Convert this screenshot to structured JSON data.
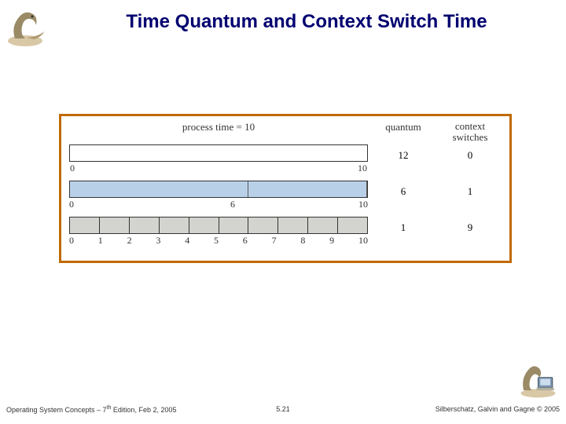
{
  "title": "Time Quantum and Context Switch Time",
  "figure": {
    "header_process": "process time = 10",
    "header_quantum": "quantum",
    "header_switches_l1": "context",
    "header_switches_l2": "switches",
    "rows": [
      {
        "quantum": "12",
        "switches": "0",
        "ticks": [
          "0",
          "10"
        ]
      },
      {
        "quantum": "6",
        "switches": "1",
        "ticks": [
          "0",
          "6",
          "10"
        ]
      },
      {
        "quantum": "1",
        "switches": "9",
        "ticks": [
          "0",
          "1",
          "2",
          "3",
          "4",
          "5",
          "6",
          "7",
          "8",
          "9",
          "10"
        ]
      }
    ]
  },
  "footer": {
    "left_a": "Operating System Concepts – 7",
    "left_sup": "th",
    "left_b": " Edition, Feb 2, 2005",
    "mid": "5.21",
    "right": "Silberschatz, Galvin and Gagne © 2005"
  },
  "chart_data": {
    "type": "table",
    "title": "Time Quantum and Context Switch Time",
    "process_time": 10,
    "columns": [
      "quantum",
      "context_switches"
    ],
    "rows": [
      {
        "quantum": 12,
        "context_switches": 0,
        "segments": 1
      },
      {
        "quantum": 6,
        "context_switches": 1,
        "segments": 2,
        "tick_mid": 6
      },
      {
        "quantum": 1,
        "context_switches": 9,
        "segments": 10
      }
    ],
    "xrange": [
      0,
      10
    ]
  }
}
